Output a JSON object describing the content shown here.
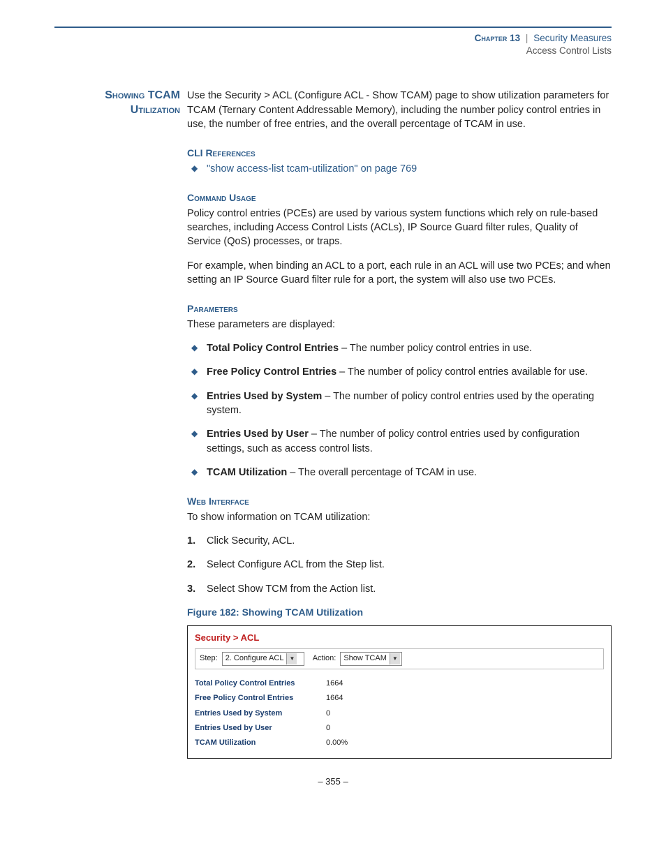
{
  "header": {
    "chapter": "Chapter 13",
    "sep": "|",
    "title1": "Security Measures",
    "title2": "Access Control Lists"
  },
  "margin_heading": "Showing TCAM Utilization",
  "intro": "Use the Security > ACL (Configure ACL - Show TCAM) page to show utilization parameters for TCAM (Ternary Content Addressable Memory), including the number policy control entries in use, the number of free entries, and the overall percentage of TCAM in use.",
  "cli_ref": {
    "heading": "CLI References",
    "link": "\"show access-list tcam-utilization\" on page 769"
  },
  "cmd_usage": {
    "heading": "Command Usage",
    "p1": "Policy control entries (PCEs) are used by various system functions which rely on rule-based searches, including Access Control Lists (ACLs), IP Source Guard filter rules, Quality of Service (QoS) processes, or traps.",
    "p2": "For example, when binding an ACL to a port, each rule in an ACL will use two PCEs; and when setting an IP Source Guard filter rule for a port, the system will also use two PCEs."
  },
  "params": {
    "heading": "Parameters",
    "intro": "These parameters are displayed:",
    "items": [
      {
        "term": "Total Policy Control Entries",
        "desc": " – The number policy control entries in use."
      },
      {
        "term": "Free Policy Control Entries",
        "desc": " – The number of policy control entries available for use."
      },
      {
        "term": "Entries Used by System",
        "desc": " – The number of policy control entries used by the operating system."
      },
      {
        "term": "Entries Used by User",
        "desc": " – The number of policy control entries used by configuration settings, such as access control lists."
      },
      {
        "term": "TCAM Utilization",
        "desc": " – The overall percentage of TCAM in use."
      }
    ]
  },
  "webif": {
    "heading": "Web Interface",
    "intro": "To show information on TCAM utilization:",
    "steps": [
      "Click Security, ACL.",
      "Select Configure ACL from the Step list.",
      "Select Show TCM from the Action list."
    ]
  },
  "figure": {
    "caption": "Figure 182:  Showing TCAM Utilization",
    "breadcrumb": "Security > ACL",
    "step_label": "Step:",
    "step_value": "2. Configure ACL",
    "action_label": "Action:",
    "action_value": "Show TCAM",
    "rows": [
      {
        "label": "Total Policy Control Entries",
        "value": "1664"
      },
      {
        "label": "Free Policy Control Entries",
        "value": "1664"
      },
      {
        "label": "Entries Used by System",
        "value": "0"
      },
      {
        "label": "Entries Used by User",
        "value": "0"
      },
      {
        "label": "TCAM Utilization",
        "value": "0.00%"
      }
    ]
  },
  "pagenum": "– 355 –"
}
